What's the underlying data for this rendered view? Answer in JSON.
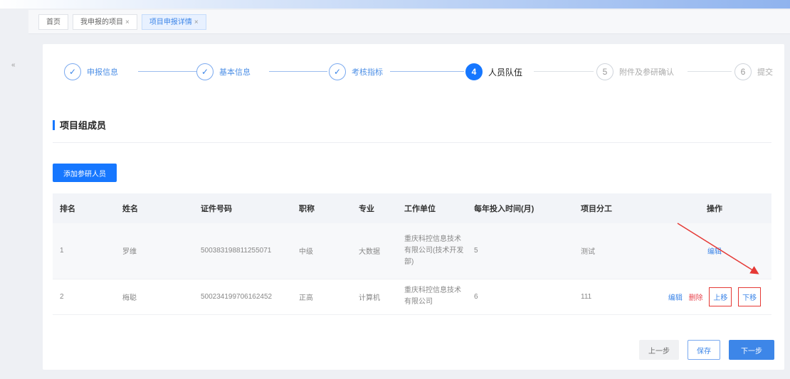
{
  "tabs": [
    {
      "label": "首页",
      "closable": false
    },
    {
      "label": "我申报的项目",
      "closable": true
    },
    {
      "label": "项目申报详情",
      "closable": true,
      "active": true
    }
  ],
  "close_glyph": "×",
  "sidebar_toggle": "«",
  "steps": [
    {
      "label": "申报信息",
      "status": "done",
      "icon": "check-icon",
      "glyph": "✓"
    },
    {
      "label": "基本信息",
      "status": "done",
      "icon": "check-icon",
      "glyph": "✓"
    },
    {
      "label": "考核指标",
      "status": "done",
      "icon": "check-icon",
      "glyph": "✓"
    },
    {
      "label": "人员队伍",
      "status": "active",
      "number": "4"
    },
    {
      "label": "附件及参研确认",
      "status": "pending",
      "number": "5"
    },
    {
      "label": "提交",
      "status": "pending",
      "number": "6"
    }
  ],
  "section_title": "项目组成员",
  "add_button": "添加参研人员",
  "table": {
    "headers": [
      "排名",
      "姓名",
      "证件号码",
      "职称",
      "专业",
      "工作单位",
      "每年投入时间(月)",
      "项目分工",
      "操作"
    ],
    "rows": [
      {
        "rank": "1",
        "name": "罗维",
        "id": "500383198811255071",
        "title": "中级",
        "major": "大数据",
        "org": "重庆科控信息技术有限公司(技术开发部)",
        "months": "5",
        "role": "测试",
        "actions": [
          "编辑"
        ]
      },
      {
        "rank": "2",
        "name": "梅聪",
        "id": "500234199706162452",
        "title": "正高",
        "major": "计算机",
        "org": "重庆科控信息技术有限公司",
        "months": "6",
        "role": "111",
        "actions": [
          "编辑",
          "删除",
          "上移",
          "下移"
        ]
      }
    ]
  },
  "footer": {
    "prev": "上一步",
    "save": "保存",
    "next": "下一步"
  },
  "colors": {
    "primary": "#1677ff",
    "danger": "#e8464f",
    "highlight": "#e53935"
  }
}
